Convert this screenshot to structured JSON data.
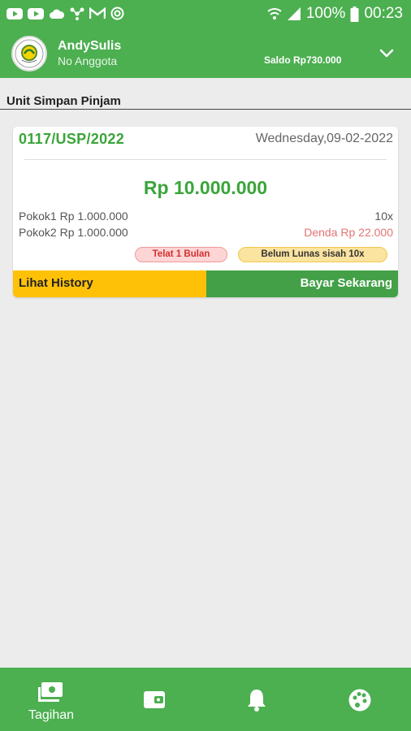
{
  "status_bar": {
    "battery": "100%",
    "time": "00:23",
    "notification_icons": [
      "youtube-icon",
      "youtube-icon",
      "cloud-icon",
      "network-icon",
      "gmail-icon",
      "sync-icon"
    ]
  },
  "header": {
    "user_name": "AndySulis",
    "user_subtitle": "No Anggota",
    "saldo": "Saldo Rp730.000"
  },
  "section": {
    "title": "Unit Simpan Pinjam"
  },
  "loan_card": {
    "code": "0117/USP/2022",
    "date": "Wednesday,09-02-2022",
    "amount": "Rp 10.000.000",
    "pokok1": "Pokok1 Rp 1.000.000",
    "pokok2": "Pokok2 Rp 1.000.000",
    "tenor": "10x",
    "denda": "Denda Rp 22.000",
    "badge_late": "Telat 1 Bulan",
    "badge_status": "Belum Lunas  sisah 10x",
    "history_button": "Lihat History",
    "pay_button": "Bayar Sekarang"
  },
  "bottom_nav": {
    "items": [
      {
        "label": "Tagihan",
        "icon": "bill-icon"
      },
      {
        "label": "",
        "icon": "wallet-icon"
      },
      {
        "label": "",
        "icon": "bell-icon"
      },
      {
        "label": "",
        "icon": "palette-icon"
      }
    ]
  },
  "colors": {
    "primary": "#4caf50",
    "accent_text": "#3aa53a",
    "history_button": "#ffc107",
    "pay_button": "#43a047",
    "danger": "#e57373"
  }
}
